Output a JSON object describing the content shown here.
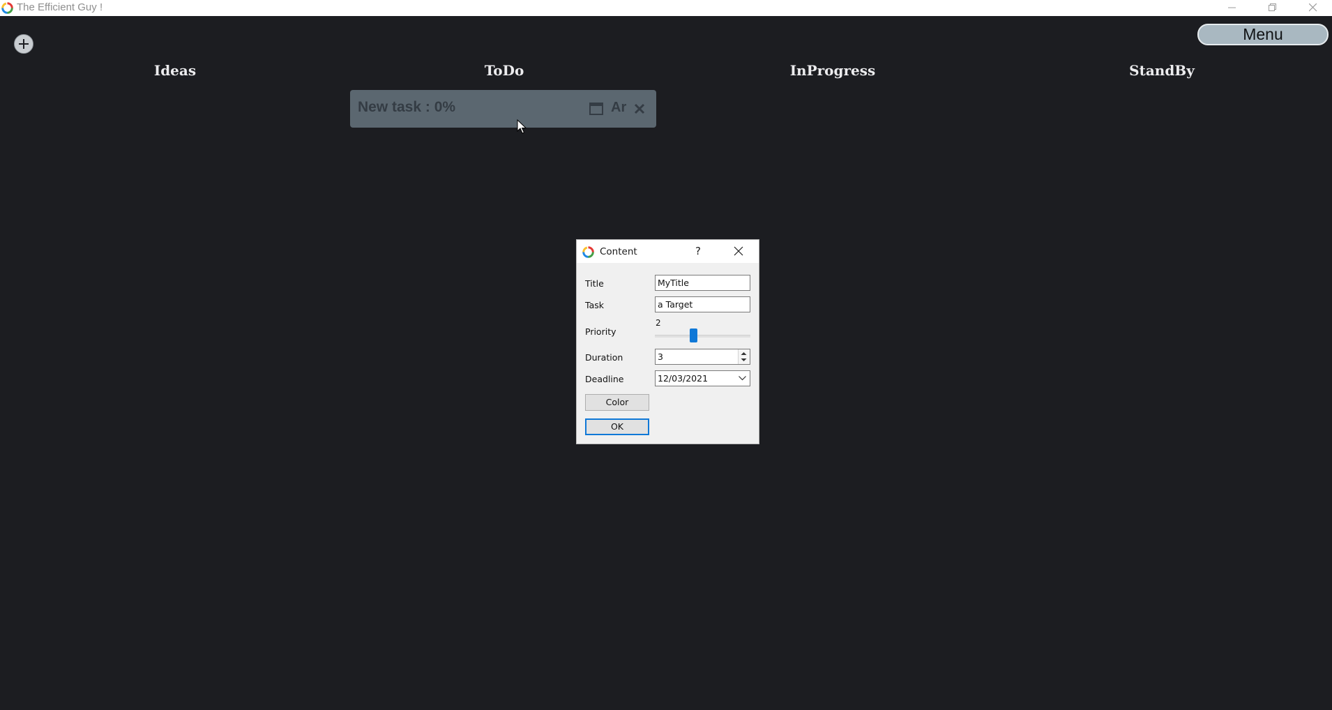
{
  "window": {
    "title": "The Efficient Guy !",
    "icon": "ring-logo-icon"
  },
  "toolbar": {
    "add_button_icon": "plus-icon",
    "menu_label": "Menu"
  },
  "columns": [
    {
      "label": "Ideas"
    },
    {
      "label": "ToDo"
    },
    {
      "label": "InProgress"
    },
    {
      "label": "StandBy"
    }
  ],
  "task_card": {
    "title": "New task : 0%",
    "archive_label": "Ar",
    "card_color": "#5b6770"
  },
  "dialog": {
    "title": "Content",
    "help": "?",
    "fields": {
      "title_label": "Title",
      "title_value": "MyTitle",
      "task_label": "Task",
      "task_value": "a Target",
      "priority_label": "Priority",
      "priority_value": "2",
      "duration_label": "Duration",
      "duration_value": "3",
      "deadline_label": "Deadline",
      "deadline_value": "12/03/2021"
    },
    "color_button": "Color",
    "ok_button": "OK",
    "accent": "#0f78d7"
  }
}
